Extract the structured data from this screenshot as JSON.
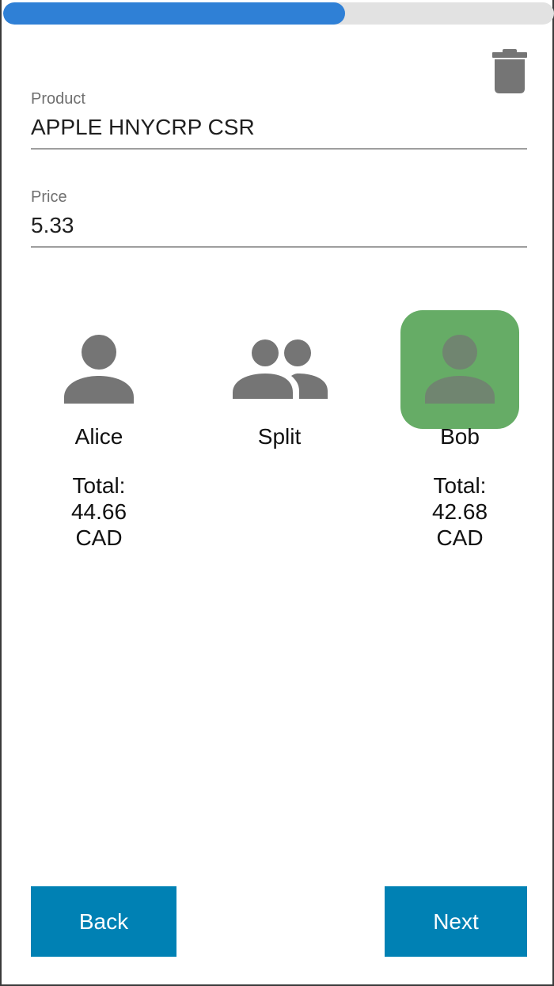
{
  "progress": {
    "fraction": 0.62,
    "fill_color": "#2f80d6",
    "track_color": "#e2e2e2"
  },
  "toolbar": {
    "delete_icon": "trash-icon"
  },
  "fields": {
    "product": {
      "label": "Product",
      "value": "APPLE HNYCRP CSR"
    },
    "price": {
      "label": "Price",
      "value": "5.33"
    }
  },
  "assignees": [
    {
      "name": "Alice",
      "total_label": "Total:",
      "total_amount": "44.66",
      "currency": "CAD",
      "icon": "person-icon",
      "selected": false
    },
    {
      "name": "Split",
      "icon": "people-icon",
      "selected": false
    },
    {
      "name": "Bob",
      "total_label": "Total:",
      "total_amount": "42.68",
      "currency": "CAD",
      "icon": "person-icon",
      "selected": true,
      "selected_color": "#66ac66"
    }
  ],
  "nav": {
    "back_label": "Back",
    "next_label": "Next",
    "button_color": "#0081b4"
  }
}
